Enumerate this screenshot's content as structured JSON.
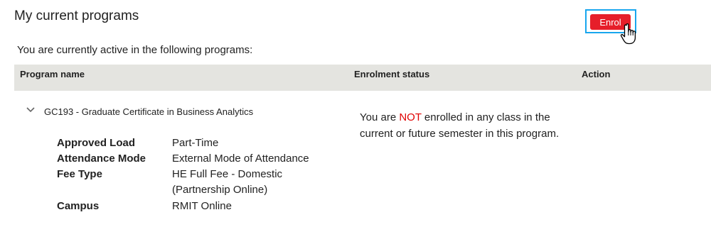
{
  "page": {
    "title": "My current programs",
    "intro": "You are currently active in the following programs:"
  },
  "table": {
    "headers": {
      "program": "Program name",
      "status": "Enrolment status",
      "action": "Action"
    }
  },
  "program": {
    "title": "GC193 - Graduate Certificate in Business Analytics",
    "details": [
      {
        "label": "Approved Load",
        "value": "Part-Time"
      },
      {
        "label": "Attendance Mode",
        "value": "External Mode of Attendance"
      },
      {
        "label": "Fee Type",
        "value": "HE Full Fee - Domestic (Partnership Online)"
      },
      {
        "label": "Campus",
        "value": "RMIT Online"
      }
    ],
    "status_prefix": "You are ",
    "status_emphasis": "NOT",
    "status_suffix": " enrolled in any class in the current or future semester in this program.",
    "action_label": "Enrol"
  },
  "colors": {
    "header_bg": "#e4e4e0",
    "enrol_button": "#e61e2a",
    "focus_outline": "#18a6ee",
    "status_emphasis": "#e00000"
  },
  "icons": {
    "expand": "chevron-down-icon",
    "cursor": "hand-pointer-icon"
  }
}
